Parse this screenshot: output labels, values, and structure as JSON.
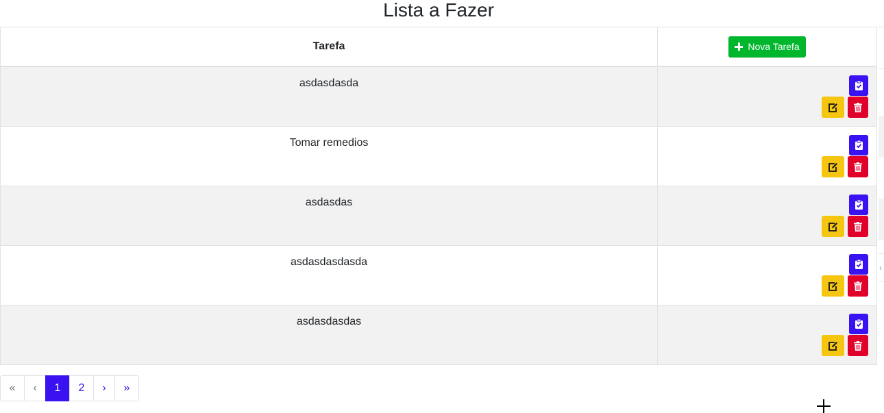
{
  "title": "Lista a Fazer",
  "table": {
    "header_task": "Tarefa",
    "new_task_label": "Nova Tarefa",
    "rows": [
      {
        "task": "asdasdasda"
      },
      {
        "task": "Tomar remedios"
      },
      {
        "task": "asdasdas"
      },
      {
        "task": "asdasdasdasda"
      },
      {
        "task": "asdasdasdas"
      }
    ]
  },
  "icons": {
    "new": "plus-icon",
    "complete": "clipboard-check-icon",
    "edit": "edit-icon",
    "delete": "trash-icon"
  },
  "colors": {
    "new_button": "#00b62d",
    "complete_button": "#3a12f2",
    "edit_button": "#f5c50f",
    "delete_button": "#e0002a",
    "pagination_accent": "#3a12f2",
    "striped_row": "#f2f2f2"
  },
  "pagination": {
    "first": "«",
    "prev": "‹",
    "pages": [
      "1",
      "2"
    ],
    "active_page": "1",
    "next": "›",
    "last": "»"
  }
}
